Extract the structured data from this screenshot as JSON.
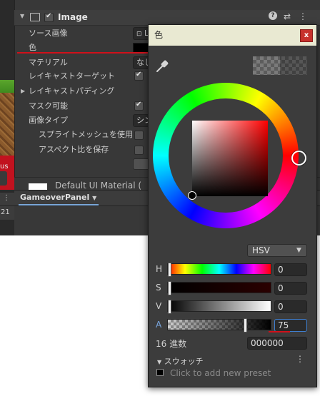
{
  "scene": {
    "label_fragment": "us",
    "bar_number": "21"
  },
  "inspector": {
    "component_title": "Image",
    "rows": {
      "source_image": "ソース画像",
      "color": "色",
      "material": "マテリアル",
      "raycast_target": "レイキャストターゲット",
      "raycast_padding": "レイキャストパディング",
      "maskable": "マスク可能",
      "image_type": "画像タイプ",
      "use_sprite_mesh": "スプライトメッシュを使用",
      "preserve_aspect": "アスペクト比を保存"
    },
    "source_image_value": "L",
    "material_value": "なし",
    "image_type_value": "シン",
    "material_footer": "Default UI Material ("
  },
  "game_panel": {
    "tab_label": "GameoverPanel"
  },
  "color_picker": {
    "title": "色",
    "close_label": "x",
    "mode": "HSV",
    "channels": [
      {
        "label": "H",
        "value": "0"
      },
      {
        "label": "S",
        "value": "0"
      },
      {
        "label": "V",
        "value": "0"
      },
      {
        "label": "A",
        "value": "75"
      }
    ],
    "hex_label": "16 進数",
    "hex_value": "000000",
    "swatches_label": "スウォッチ",
    "add_preset_text": "Click to add new preset"
  },
  "colors": {
    "accent_red": "#d0101a",
    "focus_blue": "#3f7fd0",
    "titlebar": "#e9e9d2"
  }
}
